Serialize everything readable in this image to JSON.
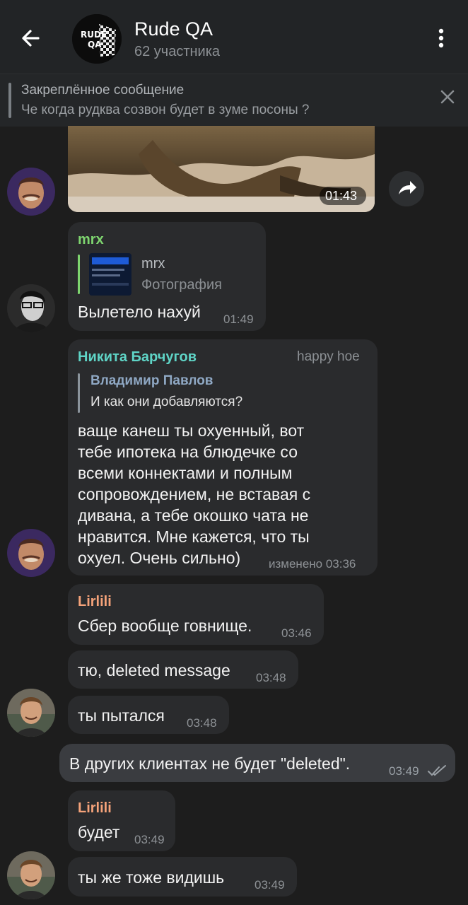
{
  "header": {
    "title": "Rude QA",
    "subtitle": "62 участника",
    "avatar_text_top": "RUDE",
    "avatar_text_bottom": "QA"
  },
  "pinned": {
    "title": "Закреплённое сообщение",
    "text": "Че когда рудква созвон будет в зуме посоны ?"
  },
  "messages": {
    "video": {
      "duration": "01:43"
    },
    "m1": {
      "author": "mrx",
      "reply_author": "mrx",
      "reply_text": "Фотография",
      "text": "Вылетело нахуй",
      "time": "01:49"
    },
    "m2": {
      "author": "Никита Барчугов",
      "badge": "happy hoe",
      "reply_author": "Владимир Павлов",
      "reply_text": "И как они добавляются?",
      "lines": [
        "ваще канеш ты охуенный, вот",
        "тебе ипотека на блюдечке со",
        "всеми коннектами и полным",
        "сопровождением, не вставая с",
        "дивана, а тебе окошко чата не",
        "нравится. Мне кажется, что ты",
        "охуел. Очень сильно)"
      ],
      "time": "изменено 03:36"
    },
    "m3": {
      "author": "Lirlili",
      "text": "Сбер вообще говнище.",
      "time": "03:46"
    },
    "m4": {
      "text": "тю, deleted message",
      "time": "03:48"
    },
    "m5": {
      "text": "ты пытался",
      "time": "03:48"
    },
    "m6": {
      "text": "В других клиентах не будет \"deleted\".",
      "time": "03:49"
    },
    "m7": {
      "author": "Lirlili",
      "text": "будет",
      "time": "03:49"
    },
    "m8": {
      "text": "ты же тоже видишь",
      "time": "03:49"
    }
  },
  "colors": {
    "mrx": "#7ed56f",
    "nikita": "#5fd4c6",
    "lirlili": "#f5a37a",
    "reply": "#8fa8c4"
  }
}
